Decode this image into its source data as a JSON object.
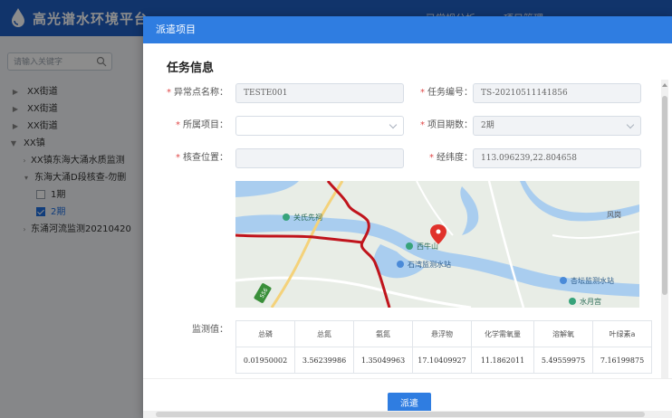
{
  "app": {
    "title": "高光谱水环境平台",
    "nav_tabs": [
      "已常规分析",
      "项目管理"
    ]
  },
  "sidebar": {
    "search_placeholder": "请输入关键字",
    "tree": [
      {
        "label": "XX街道",
        "expanded": false
      },
      {
        "label": "XX街道",
        "expanded": false
      },
      {
        "label": "XX街道",
        "expanded": false
      },
      {
        "label": "XX镇",
        "expanded": true
      },
      {
        "label": "XX镇东海大涌水质监测",
        "expanded": false
      },
      {
        "label": "东海大涌D段核查-勿删",
        "expanded": true
      },
      {
        "label": "1期",
        "checked": false
      },
      {
        "label": "2期",
        "checked": true,
        "selected": true
      },
      {
        "label": "东涌河流监测20210420",
        "expanded": false
      }
    ]
  },
  "modal": {
    "title": "派遣项目",
    "section_title": "任务信息",
    "fields": {
      "anomaly_name": {
        "label": "异常点名称：",
        "value": "TESTE001",
        "required": true
      },
      "task_no": {
        "label": "任务编号：",
        "value": "TS-20210511141856",
        "required": true
      },
      "project": {
        "label": "所属项目：",
        "value": "",
        "required": true
      },
      "period": {
        "label": "项目期数：",
        "value": "2期",
        "required": true
      },
      "location": {
        "label": "核查位置：",
        "value": "",
        "required": true
      },
      "coords": {
        "label": "经纬度：",
        "value": "113.096239,22.804658",
        "required": true
      }
    },
    "map": {
      "labels": [
        "关氏先祠",
        "西牛山",
        "石湾监测水站",
        "杏坛监测水站",
        "风岗",
        "水月宫",
        "S56"
      ]
    },
    "monitor": {
      "label": "监测值：",
      "headers": [
        "总磷",
        "总氮",
        "氨氮",
        "悬浮物",
        "化学需氧量",
        "溶解氧",
        "叶绿素a"
      ],
      "values": [
        "0.01950002",
        "3.56239986",
        "1.35049963",
        "17.10409927",
        "11.1862011",
        "5.49559975",
        "7.16199875"
      ]
    },
    "submit_label": "派遣"
  },
  "colors": {
    "header_blue": "#1f5fc4",
    "modal_header_blue": "#2f7de1",
    "required_red": "#e04848",
    "boundary_red": "#c0141c"
  }
}
